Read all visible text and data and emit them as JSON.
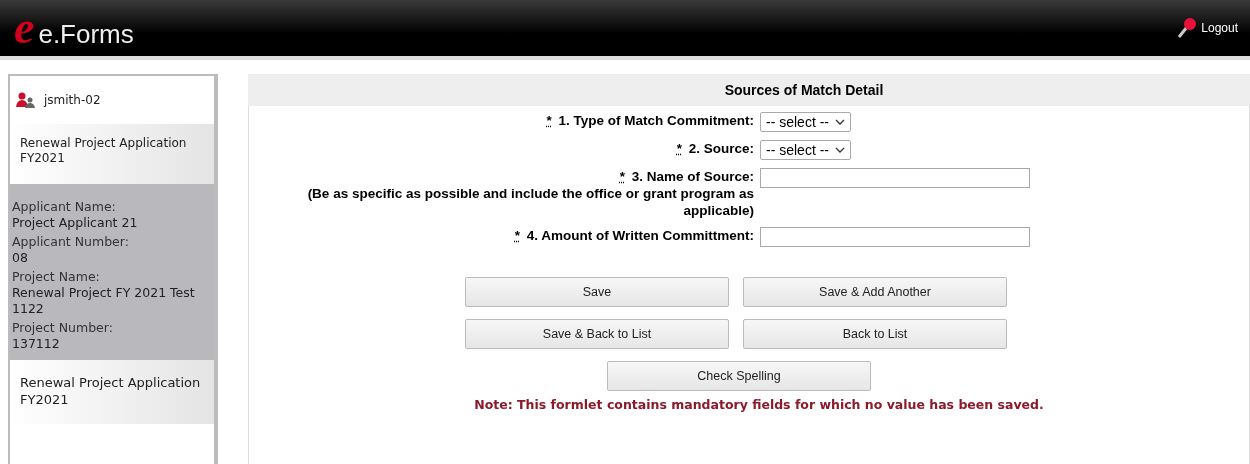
{
  "header": {
    "logo_letter": "e",
    "logo_text": "e.Forms",
    "logout": "Logout"
  },
  "sidebar": {
    "user": "jsmith-02",
    "top_link": "Renewal Project Application FY2021",
    "info": [
      {
        "label": "Applicant Name:",
        "value": "Project Applicant 21"
      },
      {
        "label": "Applicant Number:",
        "value": "08"
      },
      {
        "label": "Project Name:",
        "value": "Renewal Project FY 2021 Test 1122"
      },
      {
        "label": "Project Number:",
        "value": "137112"
      }
    ],
    "bottom_link": "Renewal Project Application FY2021"
  },
  "form": {
    "title": "Sources of Match Detail",
    "fields": [
      {
        "kind": "select",
        "required": "*",
        "label": "1. Type of Match Commitment:",
        "value": "-- select --"
      },
      {
        "kind": "select",
        "required": "*",
        "label": "2. Source:",
        "value": "-- select --"
      },
      {
        "kind": "text",
        "required": "*",
        "label": "3. Name of Source:",
        "hint": "(Be as specific as possible and include the office or grant program as applicable)"
      },
      {
        "kind": "text",
        "required": "*",
        "label": "4. Amount of Written Committment:"
      }
    ],
    "buttons": [
      "Save",
      "Save & Add Another",
      "Save & Back to List",
      "Back to List"
    ],
    "spell_button": "Check Spelling",
    "note": "Note: This formlet contains mandatory fields for which no value has been saved."
  }
}
